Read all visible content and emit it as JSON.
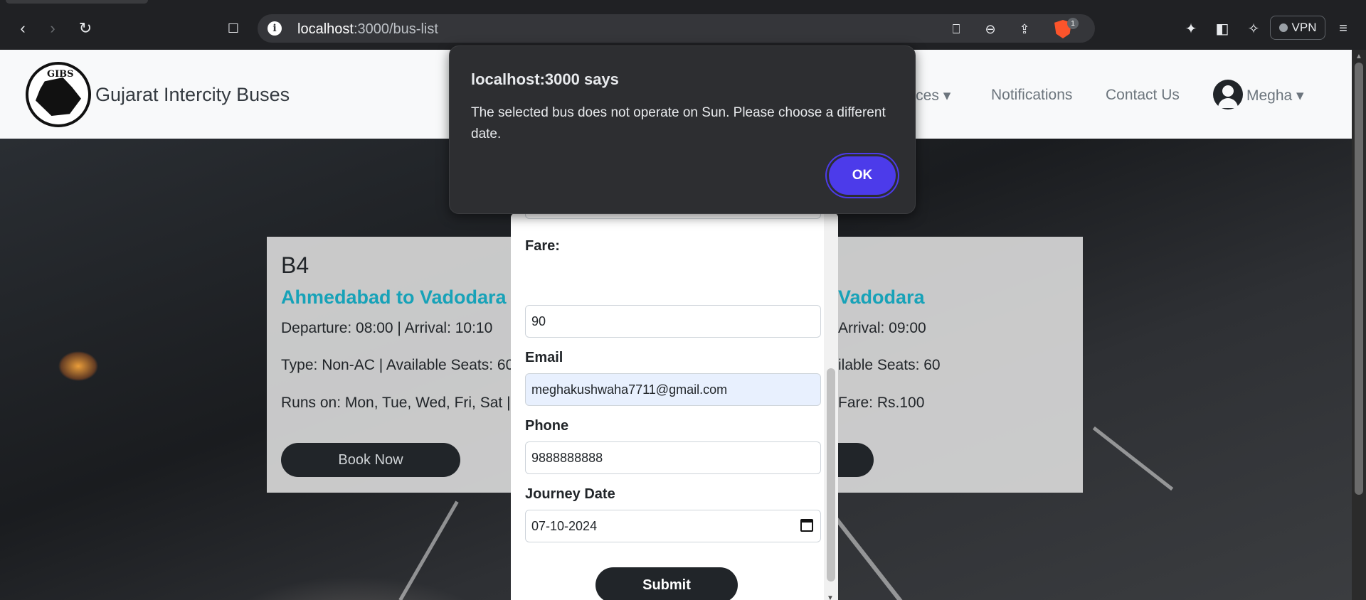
{
  "browser": {
    "url_host": "localhost",
    "url_path": ":3000/bus-list",
    "brave_badge": "1",
    "vpn_label": "VPN"
  },
  "site": {
    "brand": "Gujarat Intercity Buses",
    "logo_text": "GIBS",
    "nav": [
      "Services",
      "Notifications",
      "Contact Us"
    ],
    "nav_services_partial": "vices",
    "user": "Megha"
  },
  "cards": [
    {
      "id": "B4",
      "route": "Ahmedabad to Vadodara",
      "times": "Departure: 08:00 | Arrival: 10:10",
      "type_seats": "Type: Non-AC | Available Seats: 60",
      "runs_on": "Runs on: Mon, Tue, Wed, Fri, Sat | F",
      "book": "Book Now"
    },
    {
      "route_partial": "Vadodara",
      "arrival_partial": "Arrival: 09:00",
      "seats_partial": "ilable Seats: 60",
      "fare_partial": "Fare: Rs.100"
    }
  ],
  "modal": {
    "fare_label": "Fare:",
    "fare_value": "90",
    "email_label": "Email",
    "email_value": "meghakushwaha7711@gmail.com",
    "phone_label": "Phone",
    "phone_value": "9888888888",
    "date_label": "Journey Date",
    "date_value": "07-10-2024",
    "submit": "Submit"
  },
  "alert": {
    "title": "localhost:3000 says",
    "message": "The selected bus does not operate on Sun. Please choose a different date.",
    "ok": "OK"
  },
  "colors": {
    "route_teal": "#17a2b8",
    "ok_button": "#4c3bea",
    "dark_button": "#212529"
  }
}
